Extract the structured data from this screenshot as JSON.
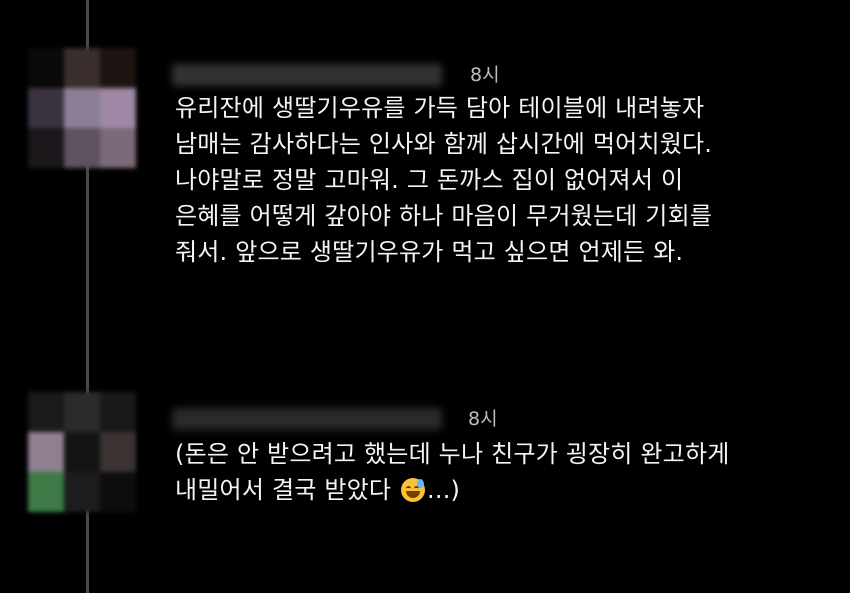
{
  "comments": [
    {
      "time": "8시",
      "lines": [
        "유리잔에 생딸기우유를 가득 담아 테이블에 내려놓자",
        "남매는 감사하다는 인사와 함께 삽시간에 먹어치웠다.",
        "나야말로 정말 고마워. 그 돈까스 집이 없어져서 이",
        "은혜를 어떻게 갚아야 하나 마음이 무거웠는데 기회를",
        "줘서. 앞으로 생딸기우유가 먹고 싶으면 언제든 와."
      ]
    },
    {
      "time": "8시",
      "lines": [
        "(돈은 안 받으려고 했는데 누나 친구가 굉장히 완고하게",
        "내밀어서 결국 받았다"
      ],
      "line2_suffix": "...)",
      "emoji": "grinning-sweat-emoji"
    }
  ],
  "colors": {
    "background": "#000000",
    "text": "#f4f4f4",
    "timestamp": "#bdbdbd",
    "thread_line": "#4a4a4a"
  }
}
